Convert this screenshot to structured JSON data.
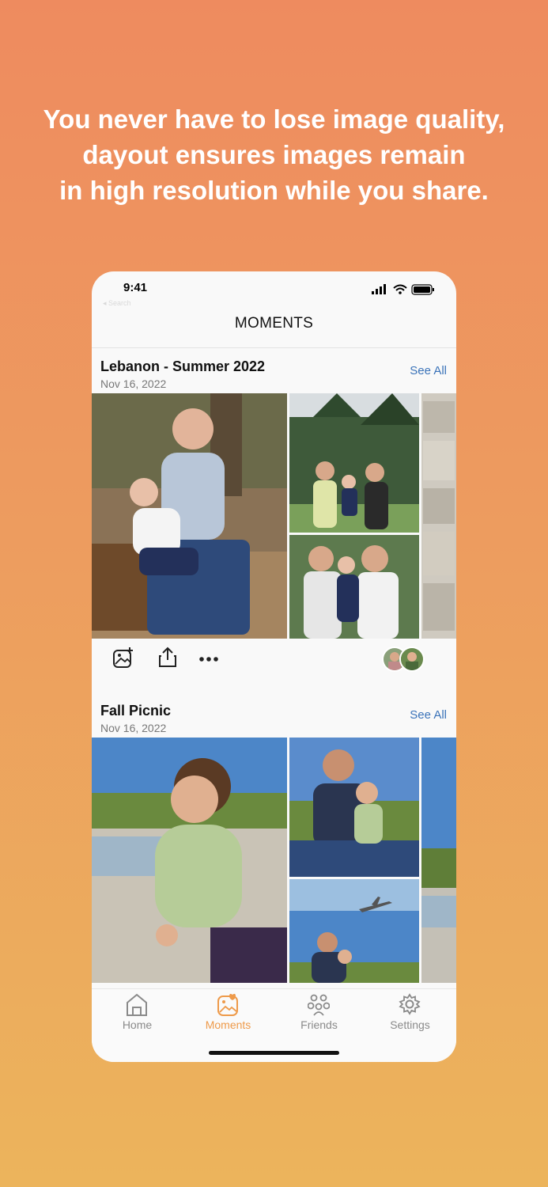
{
  "headline": {
    "line1": "You never have to lose image quality,",
    "line2": "dayout ensures images remain",
    "line3": "in high resolution while you share."
  },
  "status": {
    "time": "9:41",
    "back_label": "◂ Search"
  },
  "nav": {
    "title": "MOMENTS"
  },
  "moments": [
    {
      "title": "Lebanon - Summer 2022",
      "date": "Nov 16, 2022",
      "see_all": "See All"
    },
    {
      "title": "Fall Picnic",
      "date": "Nov 16, 2022",
      "see_all": "See All"
    }
  ],
  "tabs": [
    {
      "label": "Home",
      "icon": "home-icon"
    },
    {
      "label": "Moments",
      "icon": "moments-icon",
      "active": true
    },
    {
      "label": "Friends",
      "icon": "friends-icon"
    },
    {
      "label": "Settings",
      "icon": "gear-icon"
    }
  ],
  "colors": {
    "accent": "#ee9a4a",
    "link": "#3b73b9",
    "bg_top": "#ee8b5f",
    "bg_bottom": "#ecb45c"
  }
}
